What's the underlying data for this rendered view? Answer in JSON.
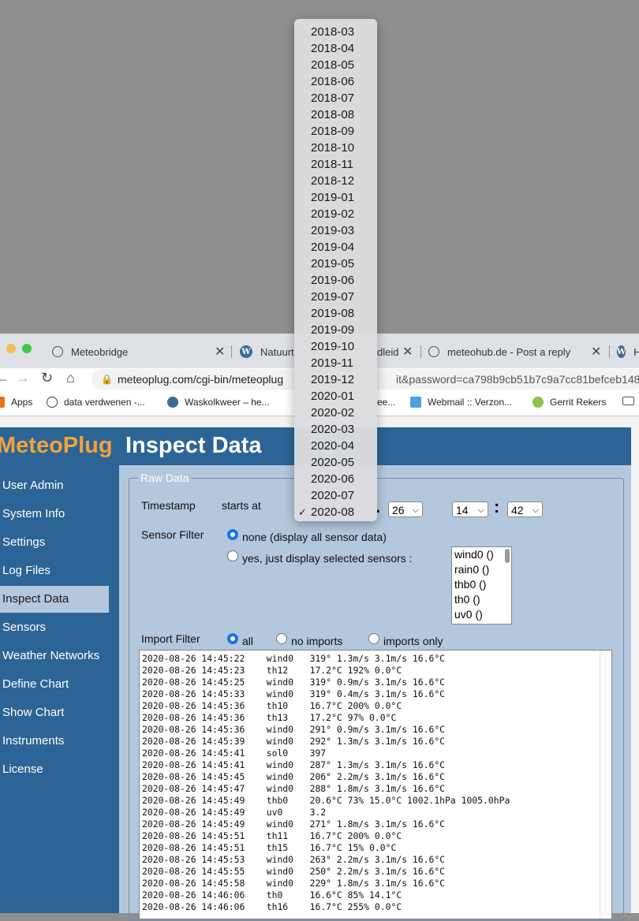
{
  "dropdown": {
    "options": [
      "2018-03",
      "2018-04",
      "2018-05",
      "2018-06",
      "2018-07",
      "2018-08",
      "2018-09",
      "2018-10",
      "2018-11",
      "2018-12",
      "2019-01",
      "2019-02",
      "2019-03",
      "2019-04",
      "2019-05",
      "2019-06",
      "2019-07",
      "2019-08",
      "2019-09",
      "2019-10",
      "2019-11",
      "2019-12",
      "2020-01",
      "2020-02",
      "2020-03",
      "2020-04",
      "2020-05",
      "2020-06",
      "2020-07",
      "2020-08"
    ],
    "selected": "2020-08",
    "check": "✓"
  },
  "browser": {
    "tabs": [
      {
        "title": "Meteobridge",
        "icon": "globe-icon"
      },
      {
        "title": "Natuurt",
        "icon": "wordpress-icon"
      },
      {
        "title": "dleid",
        "icon": "wordpress-icon"
      },
      {
        "title": "meteohub.de - Post a reply",
        "icon": "globe-icon"
      },
      {
        "title": "H",
        "icon": "wordpress-icon"
      }
    ],
    "url": "meteoplug.com/cgi-bin/meteoplug",
    "url_tail": "it&password=ca798b9cb51b7c9a7cc81befceb148",
    "bookmarks": [
      {
        "label": "Apps"
      },
      {
        "label": "data verdwenen -..."
      },
      {
        "label": "Waskolkweer – he..."
      },
      {
        "label": "ee..."
      },
      {
        "label": "Webmail :: Verzon..."
      },
      {
        "label": "Gerrit Rekers"
      }
    ]
  },
  "header": {
    "brand": "MeteoPlug",
    "title": "Inspect Data"
  },
  "sidebar": {
    "items": [
      "User Admin",
      "System Info",
      "Settings",
      "Log Files",
      "Inspect Data",
      "Sensors",
      "Weather Networks",
      "Define Chart",
      "Show Chart",
      "Instruments",
      "License"
    ],
    "active": "Inspect Data"
  },
  "raw": {
    "legend": "Raw Data",
    "timestamp_label": "Timestamp",
    "starts_at": "starts at",
    "day": "26",
    "hour": "14",
    "minute": "42",
    "colon": ":",
    "sensor_filter_label": "Sensor Filter",
    "sensor_none": "none (display all sensor data)",
    "sensor_selected": "yes, just display selected sensors :",
    "sensors": [
      "wind0 ()",
      "rain0 ()",
      "thb0 ()",
      "th0 ()",
      "uv0 ()"
    ],
    "import_filter_label": "Import Filter",
    "import_all": "all",
    "import_none": "no imports",
    "import_only": "imports only",
    "log": [
      "2020-08-26 14:45:22    wind0   319° 1.3m/s 3.1m/s 16.6°C",
      "2020-08-26 14:45:23    th12    17.2°C 192% 0.0°C",
      "2020-08-26 14:45:25    wind0   319° 0.9m/s 3.1m/s 16.6°C",
      "2020-08-26 14:45:33    wind0   319° 0.4m/s 3.1m/s 16.6°C",
      "2020-08-26 14:45:36    th10    16.7°C 200% 0.0°C",
      "2020-08-26 14:45:36    th13    17.2°C 97% 0.0°C",
      "2020-08-26 14:45:36    wind0   291° 0.9m/s 3.1m/s 16.6°C",
      "2020-08-26 14:45:39    wind0   292° 1.3m/s 3.1m/s 16.6°C",
      "2020-08-26 14:45:41    sol0    397",
      "2020-08-26 14:45:41    wind0   287° 1.3m/s 3.1m/s 16.6°C",
      "2020-08-26 14:45:45    wind0   206° 2.2m/s 3.1m/s 16.6°C",
      "2020-08-26 14:45:47    wind0   288° 1.8m/s 3.1m/s 16.6°C",
      "2020-08-26 14:45:49    thb0    20.6°C 73% 15.0°C 1002.1hPa 1005.0hPa",
      "2020-08-26 14:45:49    uv0     3.2",
      "2020-08-26 14:45:49    wind0   271° 1.8m/s 3.1m/s 16.6°C",
      "2020-08-26 14:45:51    th11    16.7°C 200% 0.0°C",
      "2020-08-26 14:45:51    th15    16.7°C 15% 0.0°C",
      "2020-08-26 14:45:53    wind0   263° 2.2m/s 3.1m/s 16.6°C",
      "2020-08-26 14:45:55    wind0   250° 2.2m/s 3.1m/s 16.6°C",
      "2020-08-26 14:45:58    wind0   229° 1.8m/s 3.1m/s 16.6°C",
      "2020-08-26 14:46:06    th0     16.6°C 85% 14.1°C",
      "2020-08-26 14:46:06    th16    16.7°C 255% 0.0°C"
    ]
  },
  "colors": {
    "brand": "#f3a33a",
    "header": "#2c6496",
    "panel": "#b3c7dd",
    "radio_on": "#1a73e8"
  }
}
